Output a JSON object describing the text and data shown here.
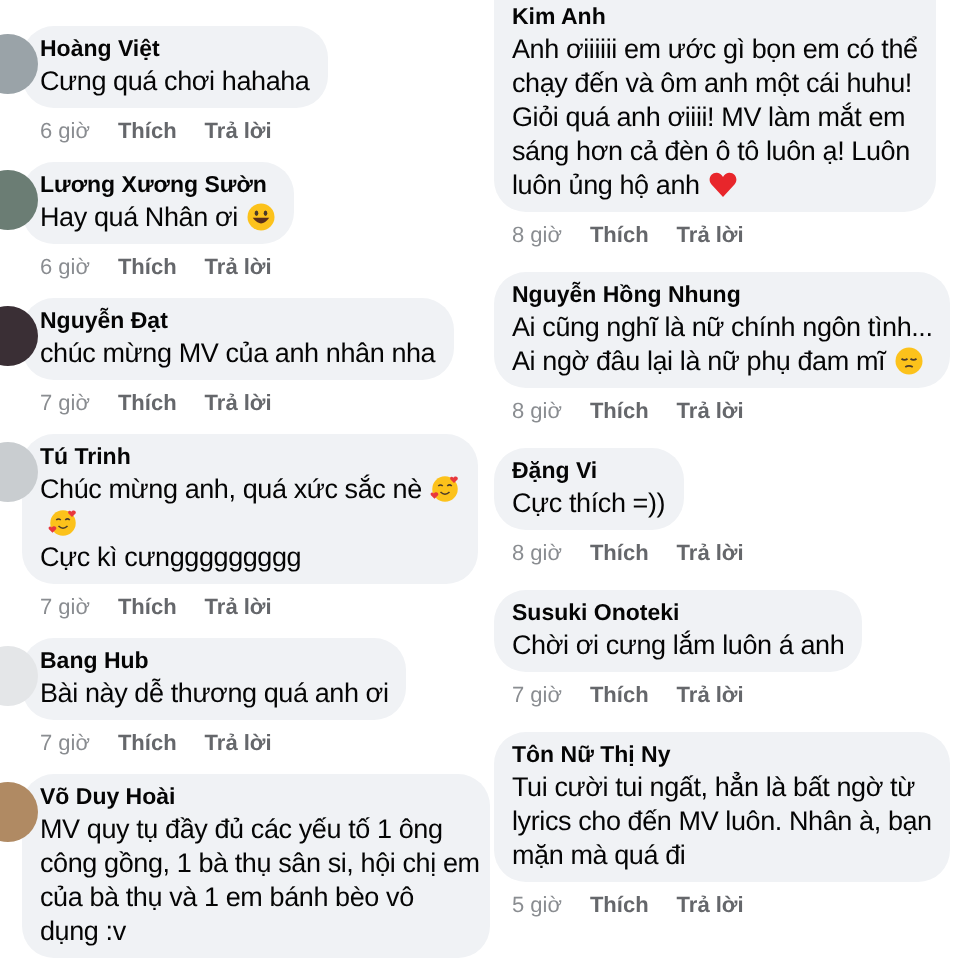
{
  "columns": [
    {
      "comments": [
        {
          "name": "Hoàng Việt",
          "parts": [
            {
              "kind": "text",
              "text": "Cưng quá chơi hahaha"
            }
          ],
          "time": "6 giờ",
          "like": "Thích",
          "reply": "Trả lời"
        },
        {
          "name": "Lương Xương Sườn",
          "parts": [
            {
              "kind": "text",
              "text": "Hay quá Nhân ơi"
            },
            {
              "kind": "grin"
            }
          ],
          "time": "6 giờ",
          "like": "Thích",
          "reply": "Trả lời"
        },
        {
          "name": "Nguyễn Đạt",
          "parts": [
            {
              "kind": "text",
              "text": "chúc mừng MV của anh nhân nha"
            }
          ],
          "time": "7 giờ",
          "like": "Thích",
          "reply": "Trả lời"
        },
        {
          "name": "Tú Trinh",
          "parts": [
            {
              "kind": "text",
              "text": "Chúc mừng anh, quá xức sắc nè"
            },
            {
              "kind": "hearts"
            },
            {
              "kind": "break"
            },
            {
              "kind": "hearts"
            },
            {
              "kind": "break"
            },
            {
              "kind": "text",
              "text": "Cực kì cưnggggggggg"
            }
          ],
          "time": "7 giờ",
          "like": "Thích",
          "reply": "Trả lời"
        },
        {
          "name": "Bang Hub",
          "parts": [
            {
              "kind": "text",
              "text": "Bài này dễ thương quá anh ơi"
            }
          ],
          "time": "7 giờ",
          "like": "Thích",
          "reply": "Trả lời"
        },
        {
          "name": "Võ Duy Hoài",
          "parts": [
            {
              "kind": "text",
              "text": "MV quy tụ đầy đủ các yếu tố 1 ông"
            },
            {
              "kind": "break"
            },
            {
              "kind": "text",
              "text": "công gồng, 1 bà thụ sân si, hội chị em"
            },
            {
              "kind": "break"
            },
            {
              "kind": "text",
              "text": "của bà thụ và 1 em bánh bèo vô"
            },
            {
              "kind": "break"
            },
            {
              "kind": "text",
              "text": "dụng :v"
            }
          ]
        }
      ]
    },
    {
      "comments": [
        {
          "name": "Kim Anh",
          "parts": [
            {
              "kind": "text",
              "text": "Anh ơiiiiii em ước gì bọn em có thể"
            },
            {
              "kind": "break"
            },
            {
              "kind": "text",
              "text": "chạy đến và ôm anh một cái huhu!"
            },
            {
              "kind": "break"
            },
            {
              "kind": "text",
              "text": "Giỏi quá anh ơiiii! MV làm mắt em"
            },
            {
              "kind": "break"
            },
            {
              "kind": "text",
              "text": "sáng hơn cả đèn ô tô luôn ạ! Luôn"
            },
            {
              "kind": "break"
            },
            {
              "kind": "text",
              "text": "luôn ủng hộ anh"
            },
            {
              "kind": "heart"
            }
          ],
          "time": "8 giờ",
          "like": "Thích",
          "reply": "Trả lời"
        },
        {
          "name": "Nguyễn Hồng Nhung",
          "parts": [
            {
              "kind": "text",
              "text": "Ai cũng nghĩ là nữ chính ngôn tình..."
            },
            {
              "kind": "break"
            },
            {
              "kind": "text",
              "text": "Ai ngờ đâu lại là nữ phụ đam mĩ"
            },
            {
              "kind": "pensive"
            }
          ],
          "time": "8 giờ",
          "like": "Thích",
          "reply": "Trả lời"
        },
        {
          "name": "Đặng Vi",
          "parts": [
            {
              "kind": "text",
              "text": "Cực thích =))"
            }
          ],
          "time": "8 giờ",
          "like": "Thích",
          "reply": "Trả lời"
        },
        {
          "name": "Susuki Onoteki",
          "parts": [
            {
              "kind": "text",
              "text": "Chời ơi cưng lắm luôn á anh"
            }
          ],
          "time": "7 giờ",
          "like": "Thích",
          "reply": "Trả lời"
        },
        {
          "name": "Tôn Nữ Thị Ny",
          "parts": [
            {
              "kind": "text",
              "text": "Tui cười tui ngất, hẳn là bất ngờ từ"
            },
            {
              "kind": "break"
            },
            {
              "kind": "text",
              "text": "lyrics cho đến MV luôn. Nhân à, bạn"
            },
            {
              "kind": "break"
            },
            {
              "kind": "text",
              "text": "mặn mà quá đi"
            }
          ],
          "time": "5 giờ",
          "like": "Thích",
          "reply": "Trả lời"
        }
      ]
    }
  ]
}
